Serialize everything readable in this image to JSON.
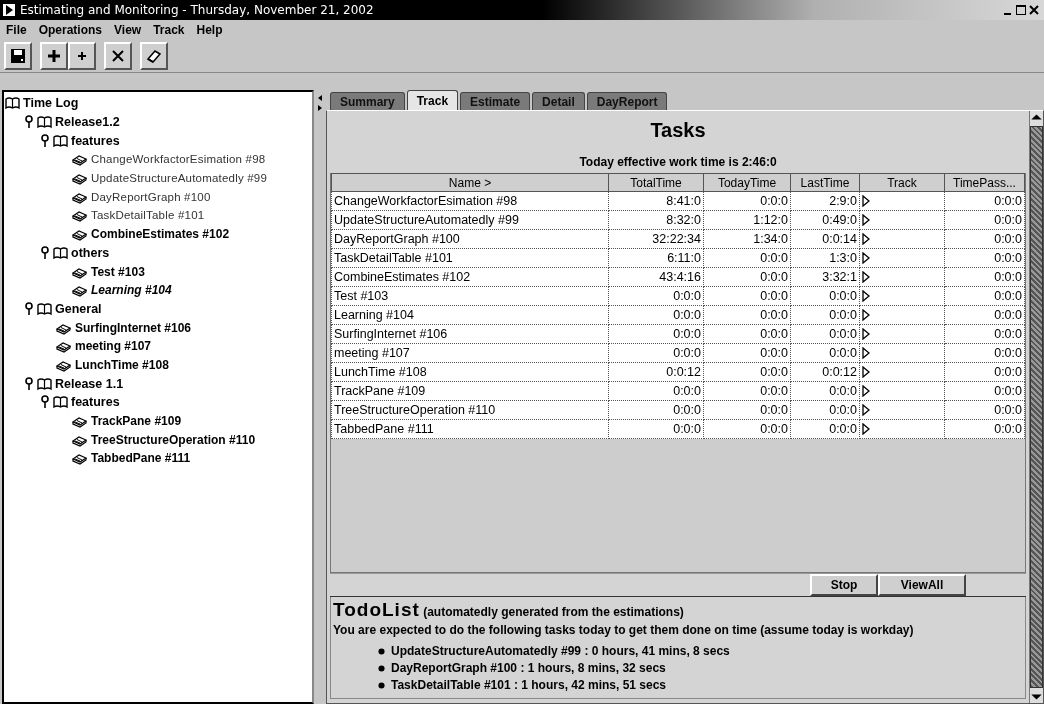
{
  "window": {
    "title": "Estimating and Monitoring - Thursday, November 21, 2002"
  },
  "menu": [
    "File",
    "Operations",
    "View",
    "Track",
    "Help"
  ],
  "toolbar": [
    {
      "kind": "save"
    },
    {
      "kind": "add-big"
    },
    {
      "kind": "add-small"
    },
    {
      "kind": "delete"
    },
    {
      "kind": "erase"
    }
  ],
  "tree": {
    "label": "Time Log",
    "children": [
      {
        "label": "Release1.2",
        "expanded": true,
        "children": [
          {
            "label": "features",
            "expanded": true,
            "children": [
              {
                "label": "ChangeWorkfactorEsimation #98",
                "dimmed": true,
                "italic": false
              },
              {
                "label": "UpdateStructureAutomatedly #99",
                "dimmed": true,
                "italic": false
              },
              {
                "label": "DayReportGraph #100",
                "dimmed": true,
                "italic": false
              },
              {
                "label": "TaskDetailTable #101",
                "dimmed": true,
                "italic": false
              },
              {
                "label": "CombineEstimates #102",
                "dimmed": false,
                "italic": false
              }
            ]
          },
          {
            "label": "others",
            "expanded": true,
            "children": [
              {
                "label": "Test #103",
                "dimmed": false,
                "italic": false
              },
              {
                "label": "Learning #104",
                "dimmed": false,
                "italic": true
              }
            ]
          }
        ]
      },
      {
        "label": "General",
        "expanded": true,
        "children": [
          {
            "label": "SurfingInternet #106",
            "dimmed": false,
            "italic": false
          },
          {
            "label": "meeting #107",
            "dimmed": false,
            "italic": false
          },
          {
            "label": "LunchTime #108",
            "dimmed": false,
            "italic": false
          }
        ]
      },
      {
        "label": "Release 1.1",
        "expanded": true,
        "children": [
          {
            "label": "features",
            "expanded": true,
            "children": [
              {
                "label": "TrackPane #109",
                "dimmed": false,
                "italic": false
              },
              {
                "label": "TreeStructureOperation #110",
                "dimmed": false,
                "italic": false
              },
              {
                "label": "TabbedPane #111",
                "dimmed": false,
                "italic": false
              }
            ]
          }
        ]
      }
    ]
  },
  "tabs": [
    {
      "label": "Summary",
      "selected": false
    },
    {
      "label": "Track",
      "selected": true
    },
    {
      "label": "Estimate",
      "selected": false
    },
    {
      "label": "Detail",
      "selected": false
    },
    {
      "label": "DayReport",
      "selected": false
    }
  ],
  "tasks": {
    "title": "Tasks",
    "subtitle": "Today effective work time is 2:46:0",
    "columns": [
      "Name >",
      "TotalTime",
      "TodayTime",
      "LastTime",
      "Track",
      "TimePass..."
    ],
    "rows": [
      [
        "ChangeWorkfactorEsimation #98",
        "8:41:0",
        "0:0:0",
        "2:9:0",
        "0:0:0"
      ],
      [
        "UpdateStructureAutomatedly #99",
        "8:32:0",
        "1:12:0",
        "0:49:0",
        "0:0:0"
      ],
      [
        "DayReportGraph #100",
        "32:22:34",
        "1:34:0",
        "0:0:14",
        "0:0:0"
      ],
      [
        "TaskDetailTable #101",
        "6:11:0",
        "0:0:0",
        "1:3:0",
        "0:0:0"
      ],
      [
        "CombineEstimates #102",
        "43:4:16",
        "0:0:0",
        "3:32:1",
        "0:0:0"
      ],
      [
        "Test #103",
        "0:0:0",
        "0:0:0",
        "0:0:0",
        "0:0:0"
      ],
      [
        "Learning #104",
        "0:0:0",
        "0:0:0",
        "0:0:0",
        "0:0:0"
      ],
      [
        "SurfingInternet #106",
        "0:0:0",
        "0:0:0",
        "0:0:0",
        "0:0:0"
      ],
      [
        "meeting #107",
        "0:0:0",
        "0:0:0",
        "0:0:0",
        "0:0:0"
      ],
      [
        "LunchTime #108",
        "0:0:12",
        "0:0:0",
        "0:0:12",
        "0:0:0"
      ],
      [
        "TrackPane #109",
        "0:0:0",
        "0:0:0",
        "0:0:0",
        "0:0:0"
      ],
      [
        "TreeStructureOperation #110",
        "0:0:0",
        "0:0:0",
        "0:0:0",
        "0:0:0"
      ],
      [
        "TabbedPane #111",
        "0:0:0",
        "0:0:0",
        "0:0:0",
        "0:0:0"
      ]
    ]
  },
  "buttons": [
    "Stop",
    "ViewAll"
  ],
  "todo": {
    "title": "TodoList",
    "note": "(automatedly generated from the estimations)",
    "intro": "You are expected to do the following tasks today to get them done on time (assume today is workday)",
    "items": [
      "UpdateStructureAutomatedly #99 : 0 hours, 41 mins, 8 secs",
      "DayReportGraph #100 : 1 hours, 8 mins, 32 secs",
      "TaskDetailTable #101 : 1 hours, 42 mins, 51 secs"
    ]
  }
}
